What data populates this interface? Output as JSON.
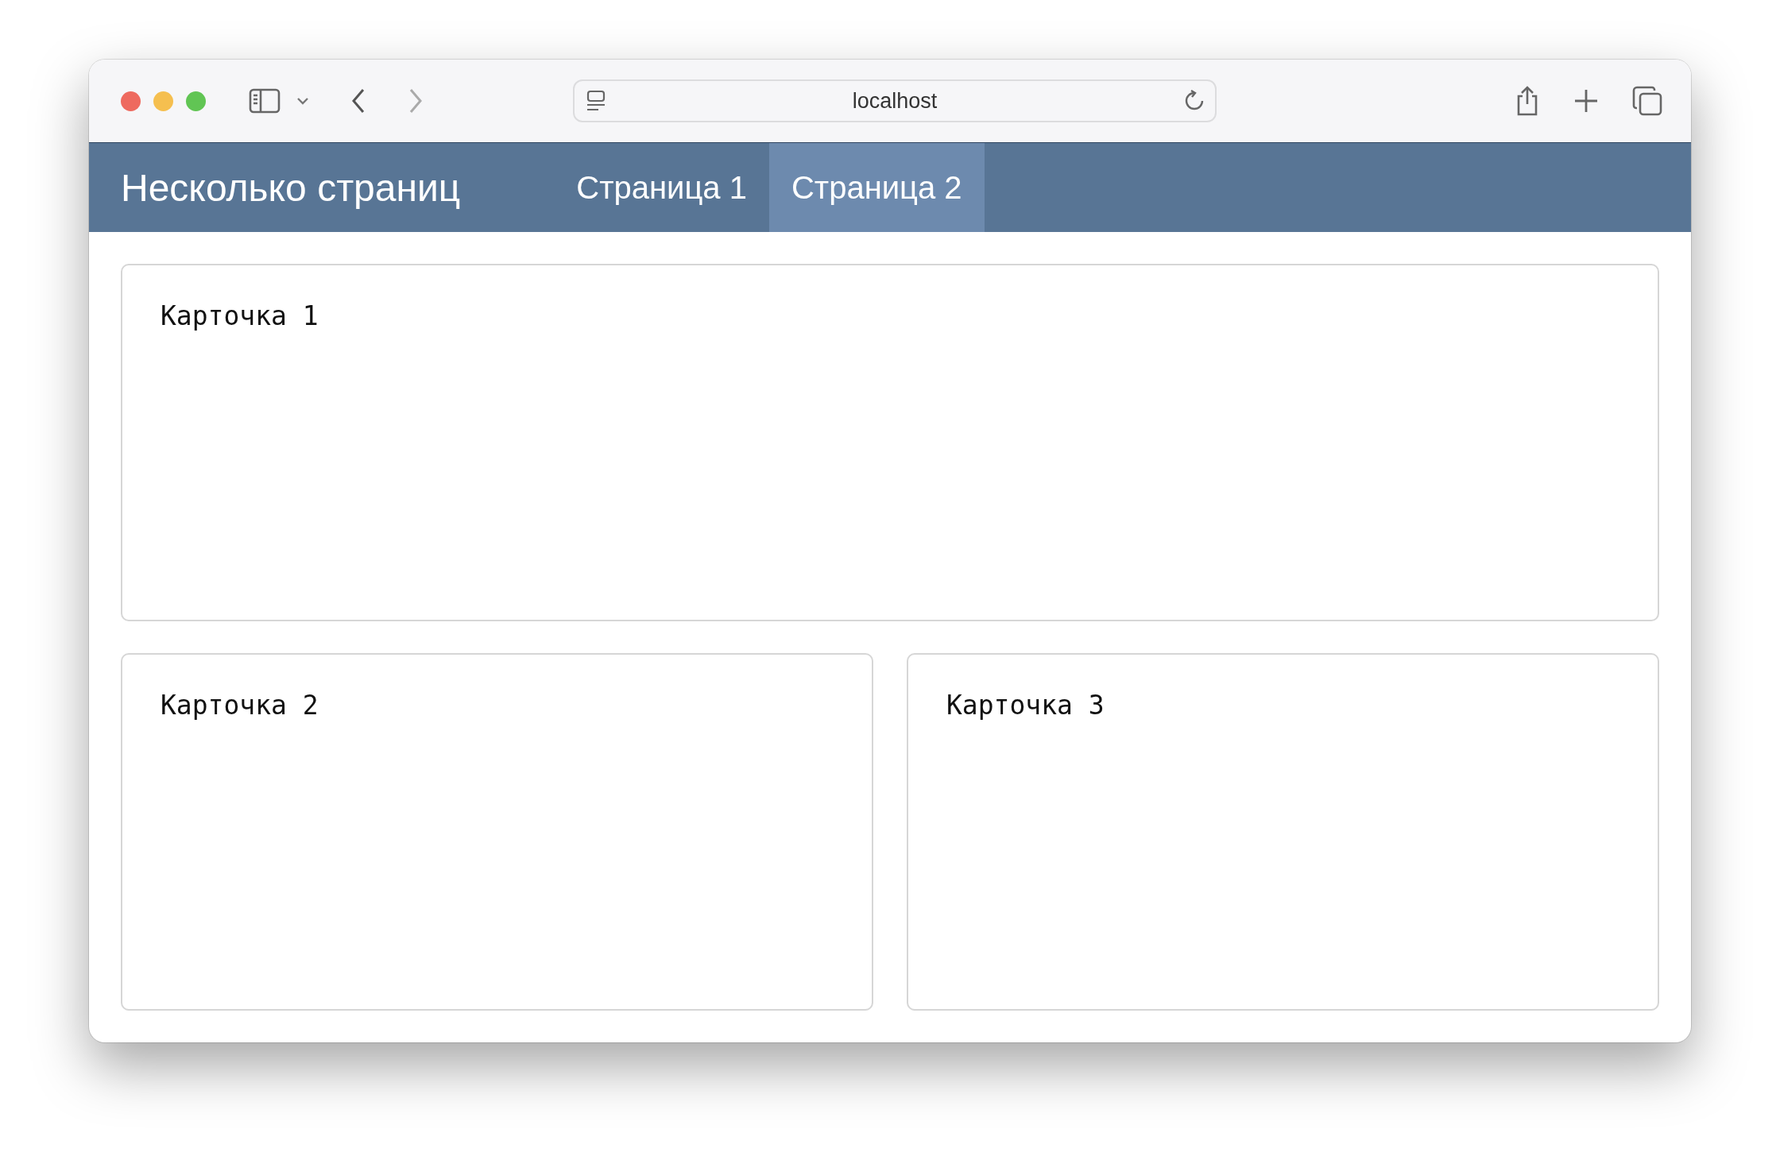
{
  "browser": {
    "address": "localhost"
  },
  "navbar": {
    "brand": "Несколько страниц",
    "tabs": [
      {
        "label": "Страница 1",
        "selected": false
      },
      {
        "label": "Страница 2",
        "selected": true
      }
    ]
  },
  "cards": [
    {
      "title": "Карточка 1",
      "kind": "wide"
    },
    {
      "title": "Карточка 2",
      "kind": "half"
    },
    {
      "title": "Карточка 3",
      "kind": "half"
    }
  ]
}
